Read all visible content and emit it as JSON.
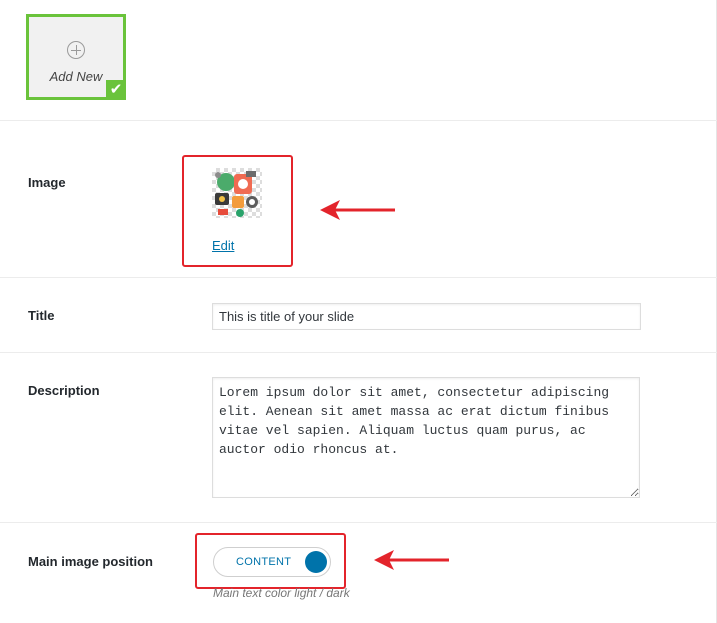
{
  "add_new": {
    "label": "Add New",
    "selected": true
  },
  "image_row": {
    "label": "Image",
    "edit_label": "Edit"
  },
  "title_row": {
    "label": "Title",
    "value": "This is title of your slide"
  },
  "description_row": {
    "label": "Description",
    "value": "Lorem ipsum dolor sit amet, consectetur adipiscing\nelit. Aenean sit amet massa ac erat dictum finibus\nvitae vel sapien. Aliquam luctus quam purus, ac\nauctor odio rhoncus at."
  },
  "position_row": {
    "label": "Main image position",
    "toggle_label": "CONTENT",
    "help_text": "Main text color light / dark"
  },
  "colors": {
    "accent": "#0073aa",
    "selected_green": "#6ac33b",
    "annotation_red": "#e3242b"
  }
}
